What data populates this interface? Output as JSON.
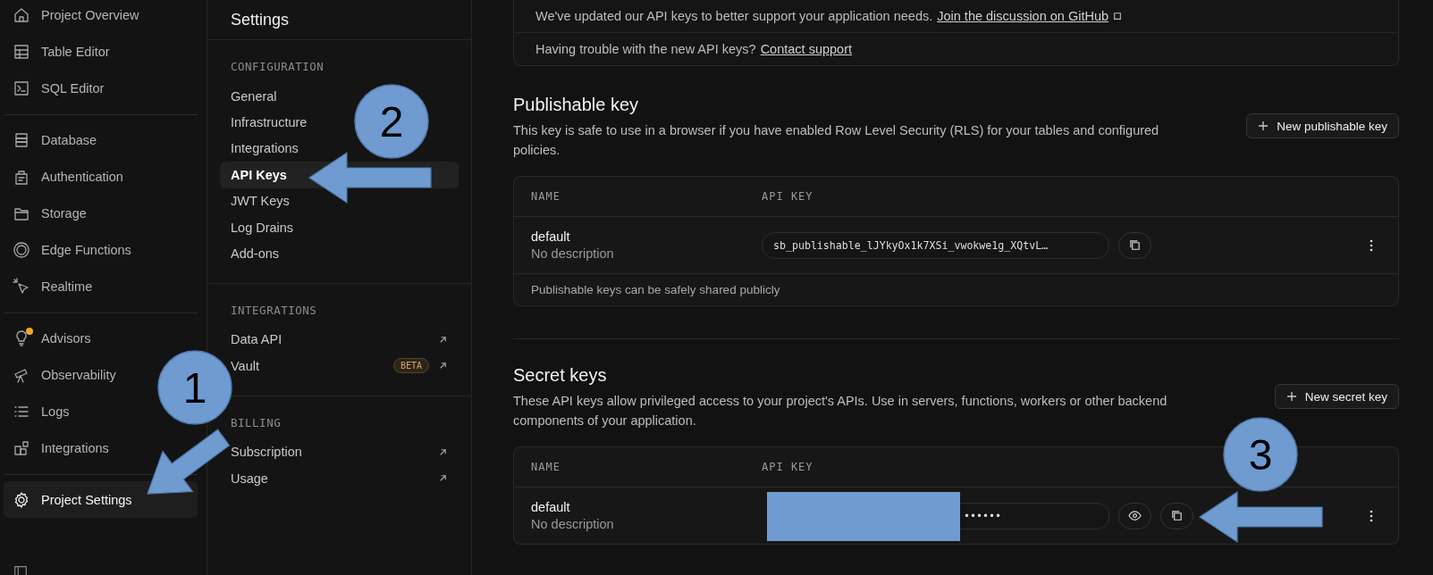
{
  "sidebar": {
    "groups": [
      {
        "items": [
          {
            "label": "Project Overview",
            "selected": false,
            "notification": false
          },
          {
            "label": "Table Editor",
            "selected": false,
            "notification": false
          },
          {
            "label": "SQL Editor",
            "selected": false,
            "notification": false
          }
        ]
      },
      {
        "items": [
          {
            "label": "Database",
            "selected": false,
            "notification": false
          },
          {
            "label": "Authentication",
            "selected": false,
            "notification": false
          },
          {
            "label": "Storage",
            "selected": false,
            "notification": false
          },
          {
            "label": "Edge Functions",
            "selected": false,
            "notification": false
          },
          {
            "label": "Realtime",
            "selected": false,
            "notification": false
          }
        ]
      },
      {
        "items": [
          {
            "label": "Advisors",
            "selected": false,
            "notification": true
          },
          {
            "label": "Observability",
            "selected": false,
            "notification": false
          },
          {
            "label": "Logs",
            "selected": false,
            "notification": false
          },
          {
            "label": "Integrations",
            "selected": false,
            "notification": false
          }
        ]
      },
      {
        "items": [
          {
            "label": "Project Settings",
            "selected": true,
            "notification": false
          }
        ]
      }
    ]
  },
  "settings": {
    "title": "Settings",
    "sections": [
      {
        "title": "CONFIGURATION",
        "items": [
          {
            "label": "General",
            "selected": false,
            "external": false
          },
          {
            "label": "Infrastructure",
            "selected": false,
            "external": false
          },
          {
            "label": "Integrations",
            "selected": false,
            "external": false
          },
          {
            "label": "API Keys",
            "selected": true,
            "external": false
          },
          {
            "label": "JWT Keys",
            "selected": false,
            "external": false
          },
          {
            "label": "Log Drains",
            "selected": false,
            "external": false
          },
          {
            "label": "Add-ons",
            "selected": false,
            "external": false
          }
        ]
      },
      {
        "title": "INTEGRATIONS",
        "items": [
          {
            "label": "Data API",
            "selected": false,
            "external": true
          },
          {
            "label": "Vault",
            "selected": false,
            "external": true,
            "badge": "BETA"
          }
        ]
      },
      {
        "title": "BILLING",
        "items": [
          {
            "label": "Subscription",
            "selected": false,
            "external": true
          },
          {
            "label": "Usage",
            "selected": false,
            "external": true
          }
        ]
      }
    ]
  },
  "notice": {
    "rows": [
      {
        "text": "We've updated our API keys to better support your application needs.",
        "link": "Join the discussion on GitHub",
        "external": true
      },
      {
        "text": "Having trouble with the new API keys?",
        "link": "Contact support",
        "external": false
      }
    ]
  },
  "key_sections": [
    {
      "title": "Publishable key",
      "description": "This key is safe to use in a browser if you have enabled Row Level Security (RLS) for your tables and configured policies.",
      "button": "New publishable key",
      "columns": [
        "NAME",
        "API KEY"
      ],
      "rows": [
        {
          "name": "default",
          "description": "No description",
          "key": "sb_publishable_lJYkyOx1k7XSi_vwokwe1g_XQtvL…",
          "revealable": false,
          "redacted": false
        }
      ],
      "footer": "Publishable keys can be safely shared publicly"
    },
    {
      "title": "Secret keys",
      "description": "These API keys allow privileged access to your project's APIs. Use in servers, functions, workers or other backend components of your application.",
      "button": "New secret key",
      "columns": [
        "NAME",
        "API KEY"
      ],
      "rows": [
        {
          "name": "default",
          "description": "No description",
          "key": "••••••",
          "revealable": true,
          "redacted": true
        }
      ]
    }
  ],
  "annotations": [
    {
      "number": "1"
    },
    {
      "number": "2"
    },
    {
      "number": "3"
    }
  ]
}
